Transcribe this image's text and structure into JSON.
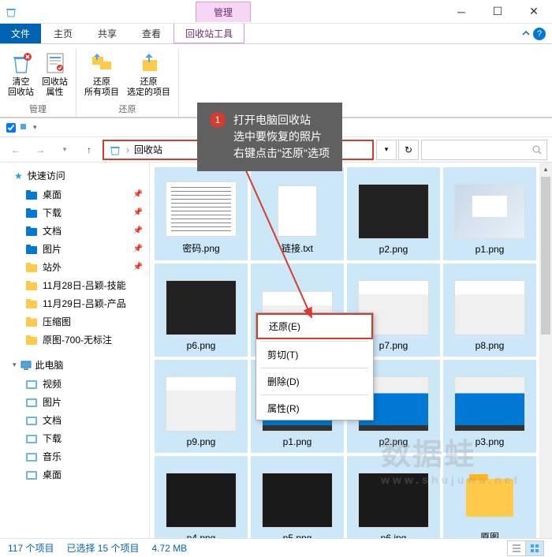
{
  "titlebar": {
    "manage": "管理"
  },
  "tabs": {
    "file": "文件",
    "home": "主页",
    "share": "共享",
    "view": "查看",
    "tools": "回收站工具"
  },
  "ribbon": {
    "empty": "清空\n回收站",
    "props": "回收站\n属性",
    "restore_all": "还原\n所有项目",
    "restore_sel": "还原\n选定的项目",
    "group1": "管理",
    "group2": "还原"
  },
  "addr": {
    "location": "回收站",
    "sep": "›"
  },
  "callout": {
    "num": "1",
    "l1": "打开电脑回收站",
    "l2": "选中要恢复的照片",
    "l3": "右键点击\"还原\"选项"
  },
  "sidebar": {
    "quick": "快速访问",
    "items": [
      {
        "label": "桌面",
        "pin": true,
        "color": "#0078d4"
      },
      {
        "label": "下载",
        "pin": true,
        "color": "#0078d4"
      },
      {
        "label": "文档",
        "pin": true,
        "color": "#0078d4"
      },
      {
        "label": "图片",
        "pin": true,
        "color": "#0078d4"
      },
      {
        "label": "站外",
        "pin": true,
        "color": "#ffc94a"
      },
      {
        "label": "11月28日-吕颖-技能",
        "pin": false,
        "color": "#ffc94a"
      },
      {
        "label": "11月29日-吕颖-产品",
        "pin": false,
        "color": "#ffc94a"
      },
      {
        "label": "压缩图",
        "pin": false,
        "color": "#ffc94a"
      },
      {
        "label": "原图-700-无标注",
        "pin": false,
        "color": "#ffc94a"
      }
    ],
    "thispc": "此电脑",
    "pc_items": [
      {
        "label": "视频"
      },
      {
        "label": "图片"
      },
      {
        "label": "文档"
      },
      {
        "label": "下载"
      },
      {
        "label": "音乐"
      },
      {
        "label": "桌面"
      }
    ]
  },
  "files": [
    {
      "name": "密码.png",
      "type": "doc"
    },
    {
      "name": "链接.txt",
      "type": "txt"
    },
    {
      "name": "p2.png",
      "type": "kb"
    },
    {
      "name": "p1.png",
      "type": "laptop"
    },
    {
      "name": "p6.png",
      "type": "stressed"
    },
    {
      "name": "",
      "type": "screen2"
    },
    {
      "name": "p7.png",
      "type": "screen2"
    },
    {
      "name": "p8.png",
      "type": "screen2"
    },
    {
      "name": "p9.png",
      "type": "screen2"
    },
    {
      "name": "p1.png",
      "type": "screen"
    },
    {
      "name": "p2.png",
      "type": "screen"
    },
    {
      "name": "p3.png",
      "type": "screen"
    },
    {
      "name": "p4.png",
      "type": "tiles"
    },
    {
      "name": "p5.png",
      "type": "tiles"
    },
    {
      "name": "p6.jpg",
      "type": "tiles"
    },
    {
      "name": "原图",
      "type": "folder"
    }
  ],
  "ctx": {
    "restore": "还原(E)",
    "cut": "剪切(T)",
    "delete": "删除(D)",
    "props": "属性(R)"
  },
  "status": {
    "count": "117 个项目",
    "sel": "已选择 15 个项目",
    "size": "4.72 MB"
  },
  "watermark": {
    "main": "数据蛙",
    "sub": "www.shujuwa.net"
  }
}
